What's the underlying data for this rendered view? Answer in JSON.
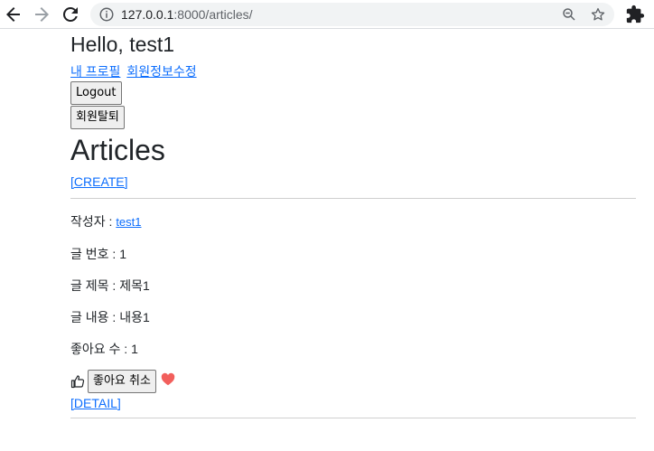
{
  "browser": {
    "url_host": "127.0.0.1",
    "url_path": ":8000/articles/"
  },
  "header": {
    "greeting": "Hello, test1",
    "profile_link": "내 프로필",
    "edit_link": "회원정보수정",
    "logout_button": "Logout",
    "withdraw_button": "회원탈퇴"
  },
  "main": {
    "title": "Articles",
    "create_link": "[CREATE]"
  },
  "article": {
    "author_label": "작성자 : ",
    "author_name": "test1",
    "number": "글 번호 : 1",
    "title": "글 제목 : 제목1",
    "content": "글 내용 : 내용1",
    "likes": "좋아요 수 : 1",
    "unlike_button": "좋아요 취소",
    "detail_link": "[DETAIL]"
  },
  "colors": {
    "link": "#0d6efd",
    "heart": "#f25f5c"
  },
  "icons": {
    "back": "back-arrow-icon",
    "forward": "forward-arrow-icon",
    "reload": "reload-icon",
    "info": "info-icon",
    "zoom": "zoom-icon",
    "bookmark": "star-icon",
    "extensions": "puzzle-icon",
    "thumb": "thumbs-up-icon",
    "heart": "heart-icon"
  }
}
